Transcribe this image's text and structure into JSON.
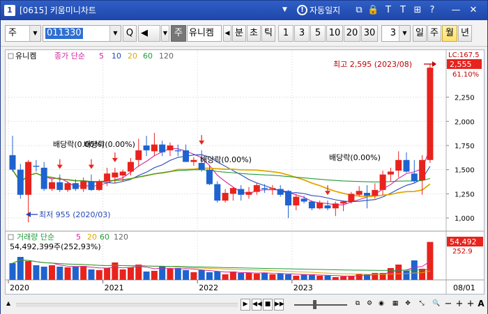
{
  "window": {
    "number": "1",
    "title": "[0615] 키움미니차트",
    "caret": "▼",
    "auto_lock": "자동일지",
    "info_glyph": "!",
    "icons": [
      "restore-icon",
      "lock-icon",
      "pin-icon",
      "text-icon",
      "grid-icon",
      "help-icon",
      "minimize-icon",
      "close-icon"
    ],
    "icon_glyphs": [
      "⧉",
      "🔒",
      "T",
      "T",
      "⊞",
      "?",
      "—",
      "✕"
    ]
  },
  "toolbar": {
    "market": "주",
    "code": "011330",
    "search_glyph": "Q",
    "speaker_glyph": "◀",
    "stock_tag": "주",
    "stock_name": "유니켐",
    "period_prev": "◀",
    "periods": [
      "분",
      "초",
      "틱"
    ],
    "numbers": [
      "1",
      "3",
      "5",
      "10",
      "20",
      "30"
    ],
    "select_value": "3",
    "spans": [
      "일",
      "주",
      "월",
      "년"
    ],
    "active_span": "월"
  },
  "price_legend": {
    "name": "유니켐",
    "ma_label": "종가 단순",
    "ma_periods": [
      "5",
      "10",
      "20",
      "60",
      "120"
    ]
  },
  "volume_legend": {
    "label": "거래량 단순",
    "ma_periods": [
      "5",
      "20",
      "60",
      "120"
    ],
    "value_text": "54,492,399주(252,93%)"
  },
  "axis": {
    "price_ticks": [
      "2,250",
      "2,000",
      "1,750",
      "1,500",
      "1,250",
      "1,000"
    ],
    "lc_label": "LC:167.5",
    "last_price": "2,555",
    "percent_label": "61.10%",
    "vol_last": "54,492",
    "vol_pct": "252.9",
    "x_labels": [
      "2020",
      "2021",
      "2022",
      "2023",
      "08/01"
    ]
  },
  "annotations": {
    "high": "최고 2,595 (2023/08)",
    "low": "최저 955 (2020/03)",
    "dividends": [
      "배당락(0.00%)",
      "배당락(0.00%)",
      "배당락(0.00%)",
      "배당락(0.00%)"
    ]
  },
  "colors": {
    "up": "#e8231d",
    "down": "#1e63cf",
    "ma5": "#d4249c",
    "ma10": "#2347b5",
    "ma20": "#e0a800",
    "ma60": "#1f9a3a",
    "ma120": "#666666"
  },
  "chart_data": {
    "type": "candlestick",
    "interval": "month",
    "x_labels": [
      "2020",
      "2021",
      "2022",
      "2023"
    ],
    "price_ylim": [
      900,
      2650
    ],
    "candles": [
      {
        "o": 1650,
        "h": 1850,
        "l": 1480,
        "c": 1500
      },
      {
        "o": 1500,
        "h": 1560,
        "l": 1200,
        "c": 1240
      },
      {
        "o": 1240,
        "h": 1600,
        "l": 955,
        "c": 1580
      },
      {
        "o": 1540,
        "h": 1600,
        "l": 1480,
        "c": 1530
      },
      {
        "o": 1520,
        "h": 1580,
        "l": 1280,
        "c": 1300
      },
      {
        "o": 1300,
        "h": 1400,
        "l": 1280,
        "c": 1370
      },
      {
        "o": 1370,
        "h": 1450,
        "l": 1270,
        "c": 1290
      },
      {
        "o": 1290,
        "h": 1380,
        "l": 1270,
        "c": 1360
      },
      {
        "o": 1360,
        "h": 1400,
        "l": 1280,
        "c": 1300
      },
      {
        "o": 1300,
        "h": 1420,
        "l": 1270,
        "c": 1380
      },
      {
        "o": 1380,
        "h": 1450,
        "l": 1280,
        "c": 1290
      },
      {
        "o": 1290,
        "h": 1400,
        "l": 1280,
        "c": 1380
      },
      {
        "o": 1380,
        "h": 1520,
        "l": 1330,
        "c": 1460
      },
      {
        "o": 1420,
        "h": 1520,
        "l": 1360,
        "c": 1470
      },
      {
        "o": 1440,
        "h": 1500,
        "l": 1380,
        "c": 1480
      },
      {
        "o": 1480,
        "h": 1620,
        "l": 1440,
        "c": 1580
      },
      {
        "o": 1600,
        "h": 1820,
        "l": 1530,
        "c": 1700
      },
      {
        "o": 1750,
        "h": 1850,
        "l": 1640,
        "c": 1700
      },
      {
        "o": 1690,
        "h": 1880,
        "l": 1640,
        "c": 1760
      },
      {
        "o": 1760,
        "h": 1800,
        "l": 1640,
        "c": 1680
      },
      {
        "o": 1700,
        "h": 1780,
        "l": 1640,
        "c": 1750
      },
      {
        "o": 1700,
        "h": 1760,
        "l": 1640,
        "c": 1690
      },
      {
        "o": 1700,
        "h": 1760,
        "l": 1580,
        "c": 1580
      },
      {
        "o": 1580,
        "h": 1630,
        "l": 1540,
        "c": 1600
      },
      {
        "o": 1570,
        "h": 1700,
        "l": 1480,
        "c": 1500
      },
      {
        "o": 1500,
        "h": 1540,
        "l": 1340,
        "c": 1350
      },
      {
        "o": 1350,
        "h": 1380,
        "l": 1160,
        "c": 1180
      },
      {
        "o": 1180,
        "h": 1300,
        "l": 1160,
        "c": 1260
      },
      {
        "o": 1250,
        "h": 1320,
        "l": 1180,
        "c": 1310
      },
      {
        "o": 1300,
        "h": 1340,
        "l": 1180,
        "c": 1240
      },
      {
        "o": 1240,
        "h": 1320,
        "l": 1200,
        "c": 1270
      },
      {
        "o": 1270,
        "h": 1360,
        "l": 1240,
        "c": 1340
      },
      {
        "o": 1310,
        "h": 1350,
        "l": 1260,
        "c": 1300
      },
      {
        "o": 1300,
        "h": 1340,
        "l": 1240,
        "c": 1310
      },
      {
        "o": 1300,
        "h": 1340,
        "l": 1220,
        "c": 1240
      },
      {
        "o": 1280,
        "h": 1290,
        "l": 1000,
        "c": 1130
      },
      {
        "o": 1130,
        "h": 1240,
        "l": 1080,
        "c": 1220
      },
      {
        "o": 1200,
        "h": 1230,
        "l": 1150,
        "c": 1170
      },
      {
        "o": 1170,
        "h": 1180,
        "l": 1080,
        "c": 1100
      },
      {
        "o": 1100,
        "h": 1180,
        "l": 1090,
        "c": 1160
      },
      {
        "o": 1130,
        "h": 1180,
        "l": 1080,
        "c": 1100
      },
      {
        "o": 1100,
        "h": 1170,
        "l": 1020,
        "c": 1150
      },
      {
        "o": 1150,
        "h": 1180,
        "l": 1070,
        "c": 1170
      },
      {
        "o": 1170,
        "h": 1270,
        "l": 1150,
        "c": 1250
      },
      {
        "o": 1240,
        "h": 1330,
        "l": 1220,
        "c": 1280
      },
      {
        "o": 1260,
        "h": 1340,
        "l": 1100,
        "c": 1230
      },
      {
        "o": 1230,
        "h": 1360,
        "l": 1200,
        "c": 1290
      },
      {
        "o": 1290,
        "h": 1490,
        "l": 1240,
        "c": 1450
      },
      {
        "o": 1450,
        "h": 1520,
        "l": 1380,
        "c": 1480
      },
      {
        "o": 1490,
        "h": 1690,
        "l": 1420,
        "c": 1600
      },
      {
        "o": 1600,
        "h": 1680,
        "l": 1470,
        "c": 1480
      },
      {
        "o": 1460,
        "h": 1600,
        "l": 1360,
        "c": 1380
      },
      {
        "o": 1390,
        "h": 1650,
        "l": 1240,
        "c": 1600
      },
      {
        "o": 1600,
        "h": 2595,
        "l": 1570,
        "c": 2555
      }
    ],
    "volume_ylim": [
      0,
      60
    ],
    "volumes": [
      24,
      33,
      27,
      21,
      19,
      21,
      19,
      18,
      19,
      20,
      15,
      14,
      17,
      25,
      15,
      18,
      22,
      12,
      13,
      20,
      16,
      17,
      14,
      11,
      14,
      11,
      12,
      8,
      12,
      10,
      10,
      9,
      10,
      8,
      9,
      8,
      6,
      8,
      7,
      6,
      6,
      4,
      5,
      6,
      9,
      8,
      10,
      10,
      17,
      22,
      13,
      28,
      16,
      54.49
    ],
    "dividend_months": [
      6,
      10,
      13,
      24,
      40
    ],
    "x_label_months": [
      0,
      12,
      24,
      36
    ]
  }
}
